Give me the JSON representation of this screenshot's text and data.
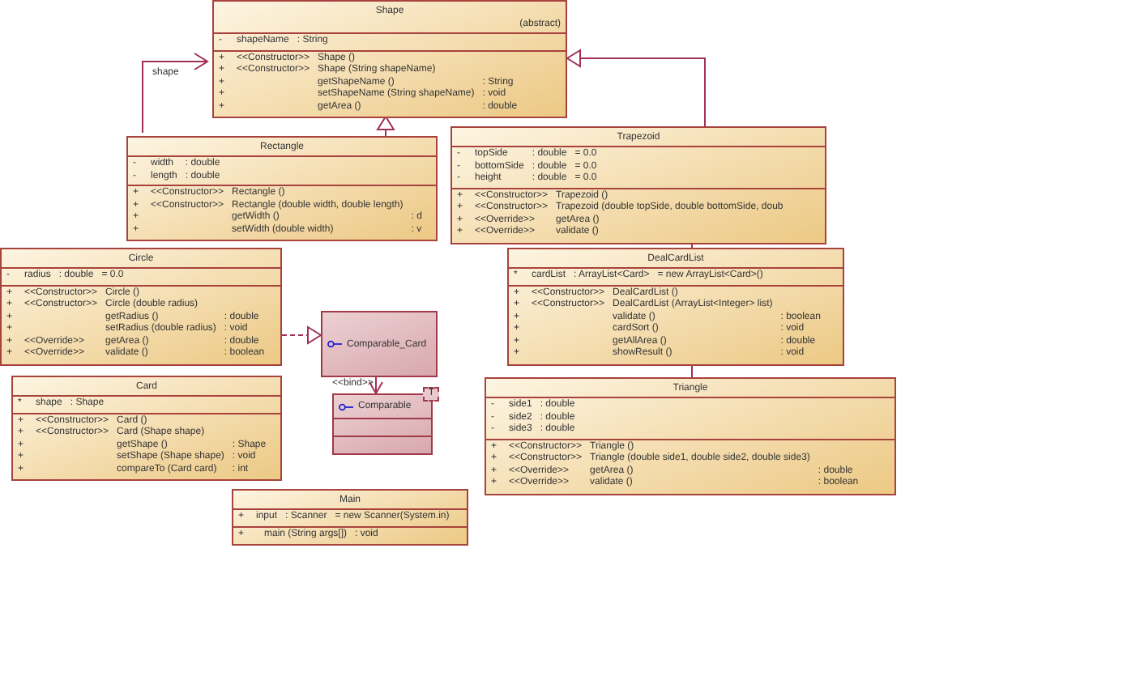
{
  "classes": [
    {
      "kind": "class",
      "name": "Shape",
      "modifier": "(abstract)",
      "attributes": [
        {
          "visibility": "-",
          "name": "shapeName",
          "type": ": String"
        }
      ],
      "operations": [
        {
          "visibility": "+",
          "stereotype": "<<Constructor>>",
          "name": "Shape ()"
        },
        {
          "visibility": "+",
          "stereotype": "<<Constructor>>",
          "name": "Shape (String shapeName)"
        },
        {
          "visibility": "+",
          "name": "getShapeName ()",
          "return": ": String"
        },
        {
          "visibility": "+",
          "name": "setShapeName (String shapeName)",
          "return": ": void"
        },
        {
          "visibility": "+",
          "name": "getArea ()",
          "return": ": double"
        }
      ]
    },
    {
      "kind": "class",
      "name": "Rectangle",
      "attributes": [
        {
          "visibility": "-",
          "name": "width",
          "type": ": double"
        },
        {
          "visibility": "-",
          "name": "length",
          "type": ": double"
        }
      ],
      "operations": [
        {
          "visibility": "+",
          "stereotype": "<<Constructor>>",
          "name": "Rectangle ()"
        },
        {
          "visibility": "+",
          "stereotype": "<<Constructor>>",
          "name": "Rectangle (double width, double length)"
        },
        {
          "visibility": "+",
          "name": "getWidth ()",
          "return": ": d"
        },
        {
          "visibility": "+",
          "name": "setWidth (double width)",
          "return": ": v"
        }
      ]
    },
    {
      "kind": "class",
      "name": "Trapezoid",
      "attributes": [
        {
          "visibility": "-",
          "name": "topSide",
          "type": ": double",
          "default": "= 0.0"
        },
        {
          "visibility": "-",
          "name": "bottomSide",
          "type": ": double",
          "default": "= 0.0"
        },
        {
          "visibility": "-",
          "name": "height",
          "type": ": double",
          "default": "= 0.0"
        }
      ],
      "operations": [
        {
          "visibility": "+",
          "stereotype": "<<Constructor>>",
          "name": "Trapezoid ()"
        },
        {
          "visibility": "+",
          "stereotype": "<<Constructor>>",
          "name": "Trapezoid (double topSide, double bottomSide, doub"
        },
        {
          "visibility": "+",
          "stereotype": "<<Override>>",
          "name": "getArea ()"
        },
        {
          "visibility": "+",
          "stereotype": "<<Override>>",
          "name": "validate ()"
        }
      ]
    },
    {
      "kind": "class",
      "name": "Circle",
      "attributes": [
        {
          "visibility": "-",
          "name": "radius",
          "type": ": double",
          "default": "= 0.0"
        }
      ],
      "operations": [
        {
          "visibility": "+",
          "stereotype": "<<Constructor>>",
          "name": "Circle ()"
        },
        {
          "visibility": "+",
          "stereotype": "<<Constructor>>",
          "name": "Circle (double radius)"
        },
        {
          "visibility": "+",
          "name": "getRadius ()",
          "return": ": double"
        },
        {
          "visibility": "+",
          "name": "setRadius (double radius)",
          "return": ": void"
        },
        {
          "visibility": "+",
          "stereotype": "<<Override>>",
          "name": "getArea ()",
          "return": ": double"
        },
        {
          "visibility": "+",
          "stereotype": "<<Override>>",
          "name": "validate ()",
          "return": ": boolean"
        }
      ]
    },
    {
      "kind": "class",
      "name": "Card",
      "attributes": [
        {
          "visibility": "*",
          "name": "shape",
          "type": ": Shape"
        }
      ],
      "operations": [
        {
          "visibility": "+",
          "stereotype": "<<Constructor>>",
          "name": "Card ()"
        },
        {
          "visibility": "+",
          "stereotype": "<<Constructor>>",
          "name": "Card (Shape shape)"
        },
        {
          "visibility": "+",
          "name": "getShape ()",
          "return": ": Shape"
        },
        {
          "visibility": "+",
          "name": "setShape (Shape shape)",
          "return": ": void"
        },
        {
          "visibility": "+",
          "name": "compareTo (Card card)",
          "return": ": int"
        }
      ]
    },
    {
      "kind": "interface",
      "name": "Comparable_Card"
    },
    {
      "kind": "template",
      "name": "Comparable",
      "parameter": "T"
    },
    {
      "kind": "class",
      "name": "DealCardList",
      "attributes": [
        {
          "visibility": "*",
          "name": "cardList",
          "type": ": ArrayList<Card>",
          "default": "= new ArrayList<Card>()"
        }
      ],
      "operations": [
        {
          "visibility": "+",
          "stereotype": "<<Constructor>>",
          "name": "DealCardList ()"
        },
        {
          "visibility": "+",
          "stereotype": "<<Constructor>>",
          "name": "DealCardList (ArrayList<Integer> list)"
        },
        {
          "visibility": "+",
          "name": "validate ()",
          "return": ": boolean"
        },
        {
          "visibility": "+",
          "name": "cardSort ()",
          "return": ": void"
        },
        {
          "visibility": "+",
          "name": "getAllArea ()",
          "return": ": double"
        },
        {
          "visibility": "+",
          "name": "showResult ()",
          "return": ": void"
        }
      ]
    },
    {
      "kind": "class",
      "name": "Triangle",
      "attributes": [
        {
          "visibility": "-",
          "name": "side1",
          "type": ": double"
        },
        {
          "visibility": "-",
          "name": "side2",
          "type": ": double"
        },
        {
          "visibility": "-",
          "name": "side3",
          "type": ": double"
        }
      ],
      "operations": [
        {
          "visibility": "+",
          "stereotype": "<<Constructor>>",
          "name": "Triangle ()"
        },
        {
          "visibility": "+",
          "stereotype": "<<Constructor>>",
          "name": "Triangle (double side1, double side2, double side3)"
        },
        {
          "visibility": "+",
          "stereotype": "<<Override>>",
          "name": "getArea ()",
          "return": ": double"
        },
        {
          "visibility": "+",
          "stereotype": "<<Override>>",
          "name": "validate ()",
          "return": ": boolean"
        }
      ]
    },
    {
      "kind": "class",
      "name": "Main",
      "attributes": [
        {
          "visibility": "+",
          "name": "input",
          "type": ": Scanner",
          "default": "= new Scanner(System.in)"
        }
      ],
      "operations": [
        {
          "visibility": "+",
          "name": "main (String args[])",
          "return": ": void"
        }
      ]
    }
  ],
  "relations": [
    {
      "kind": "generalization"
    },
    {
      "kind": "generalization"
    },
    {
      "kind": "association",
      "label": "shape"
    },
    {
      "kind": "link"
    },
    {
      "kind": "link"
    },
    {
      "kind": "realization"
    },
    {
      "kind": "bind",
      "label": "<<bind>>"
    }
  ]
}
